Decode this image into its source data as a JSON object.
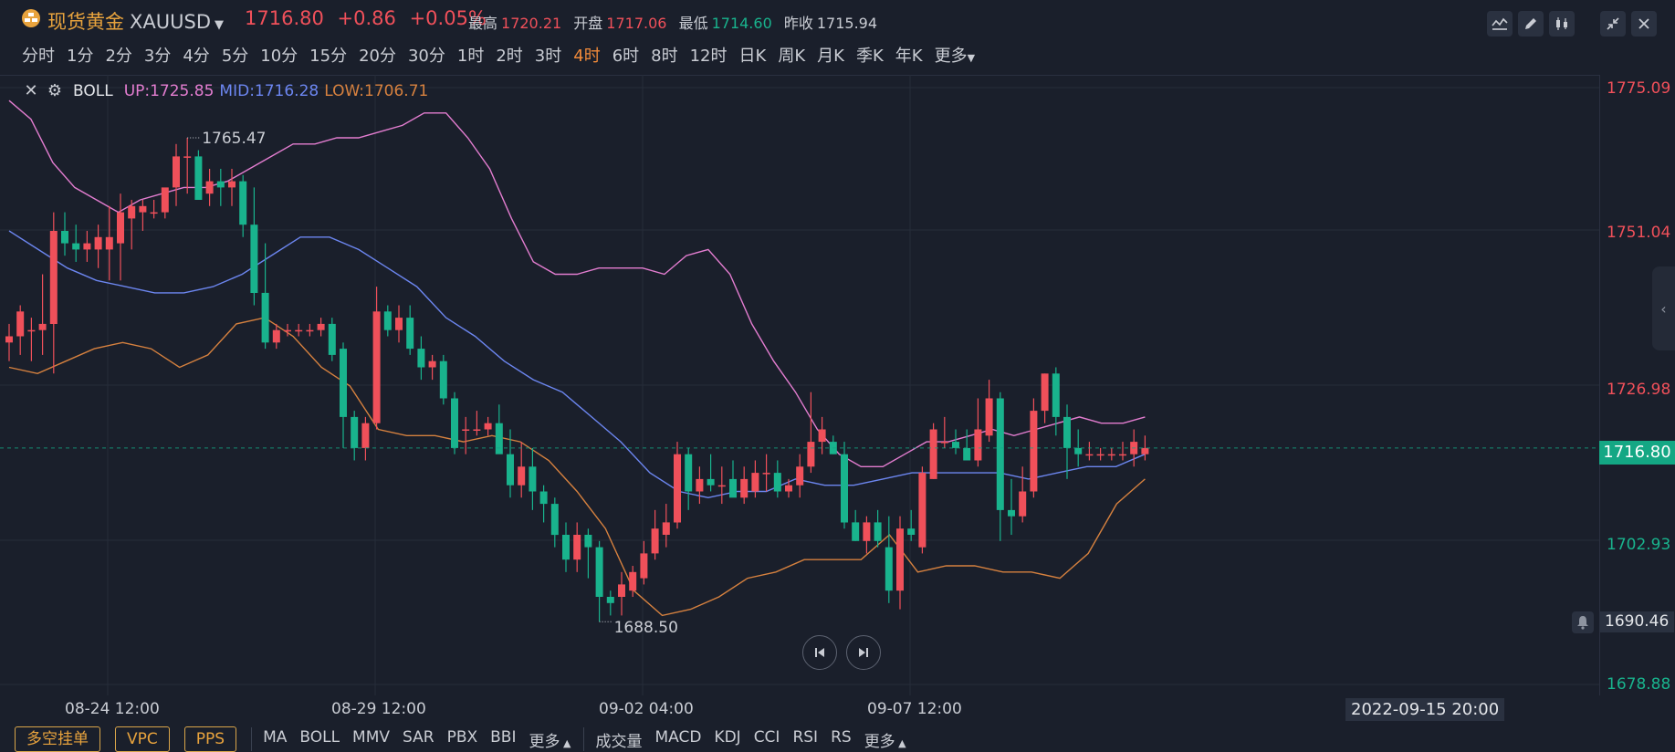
{
  "header": {
    "title_cn": "现货黄金",
    "symbol": "XAUUSD",
    "price": "1716.80",
    "change": "+0.86",
    "change_pct": "+0.05%",
    "stats": [
      {
        "label": "最高",
        "value": "1720.21",
        "color": "red"
      },
      {
        "label": "开盘",
        "value": "1717.06",
        "color": "red"
      },
      {
        "label": "最低",
        "value": "1714.60",
        "color": "green"
      },
      {
        "label": "昨收",
        "value": "1715.94",
        "color": "white"
      }
    ]
  },
  "timeframes": [
    "分时",
    "1分",
    "2分",
    "3分",
    "4分",
    "5分",
    "10分",
    "15分",
    "20分",
    "30分",
    "1时",
    "2时",
    "3时",
    "4时",
    "6时",
    "8时",
    "12时",
    "日K",
    "周K",
    "月K",
    "季K",
    "年K",
    "更多"
  ],
  "active_timeframe": "4时",
  "indicator": {
    "name": "BOLL",
    "up": "UP:1725.85",
    "mid": "MID:1716.28",
    "low": "LOW:1706.71"
  },
  "y_axis": {
    "labels": [
      {
        "text": "1775.09",
        "color": "red"
      },
      {
        "text": "1751.04",
        "color": "red"
      },
      {
        "text": "1726.98",
        "color": "red"
      },
      {
        "text": "1702.93",
        "color": "green"
      },
      {
        "text": "1690.46",
        "color": "white"
      },
      {
        "text": "1678.88",
        "color": "green"
      }
    ],
    "current_price": "1716.80"
  },
  "x_axis": {
    "labels": [
      "08-24 12:00",
      "08-29 12:00",
      "09-02 04:00",
      "09-07 12:00"
    ],
    "current": "2022-09-15 20:00"
  },
  "annotations": {
    "high": "1765.47",
    "low": "1688.50"
  },
  "bottom": {
    "buttons": [
      "多空挂单",
      "VPC",
      "PPS"
    ],
    "main_indicators": [
      "MA",
      "BOLL",
      "MMV",
      "SAR",
      "PBX",
      "BBI",
      "更多"
    ],
    "sub_indicators": [
      "成交量",
      "MACD",
      "KDJ",
      "CCI",
      "RSI",
      "RS",
      "更多"
    ]
  },
  "colors": {
    "up": "#f0505a",
    "down": "#19b38d",
    "boll_up": "#e37dd0",
    "boll_mid": "#6c86f0",
    "boll_low": "#d6813f",
    "accent": "#e8a33d"
  },
  "chart_data": {
    "type": "candlestick",
    "ylim": [
      1678.88,
      1775.09
    ],
    "candles": [
      {
        "o": 1734,
        "h": 1737,
        "l": 1731,
        "c": 1735
      },
      {
        "o": 1735,
        "h": 1740,
        "l": 1732,
        "c": 1739
      },
      {
        "o": 1736,
        "h": 1738,
        "l": 1731,
        "c": 1736
      },
      {
        "o": 1736,
        "h": 1745,
        "l": 1732,
        "c": 1737
      },
      {
        "o": 1737,
        "h": 1755,
        "l": 1729,
        "c": 1752
      },
      {
        "o": 1752,
        "h": 1755,
        "l": 1748,
        "c": 1750
      },
      {
        "o": 1750,
        "h": 1753,
        "l": 1747,
        "c": 1749
      },
      {
        "o": 1749,
        "h": 1752,
        "l": 1747,
        "c": 1750
      },
      {
        "o": 1749,
        "h": 1753,
        "l": 1746,
        "c": 1751
      },
      {
        "o": 1749,
        "h": 1756,
        "l": 1744,
        "c": 1751
      },
      {
        "o": 1750,
        "h": 1758,
        "l": 1744,
        "c": 1755
      },
      {
        "o": 1754,
        "h": 1757,
        "l": 1749,
        "c": 1756
      },
      {
        "o": 1755,
        "h": 1757,
        "l": 1752,
        "c": 1756
      },
      {
        "o": 1755,
        "h": 1757,
        "l": 1754,
        "c": 1755
      },
      {
        "o": 1755,
        "h": 1758,
        "l": 1754,
        "c": 1759
      },
      {
        "o": 1759,
        "h": 1766,
        "l": 1756,
        "c": 1764
      },
      {
        "o": 1764,
        "h": 1767,
        "l": 1758,
        "c": 1764
      },
      {
        "o": 1764,
        "h": 1765,
        "l": 1757,
        "c": 1757
      },
      {
        "o": 1758,
        "h": 1762,
        "l": 1756,
        "c": 1760
      },
      {
        "o": 1760,
        "h": 1762,
        "l": 1756,
        "c": 1759
      },
      {
        "o": 1759,
        "h": 1762,
        "l": 1756,
        "c": 1760
      },
      {
        "o": 1760,
        "h": 1761,
        "l": 1751,
        "c": 1753
      },
      {
        "o": 1753,
        "h": 1759,
        "l": 1740,
        "c": 1742
      },
      {
        "o": 1742,
        "h": 1750,
        "l": 1733,
        "c": 1734
      },
      {
        "o": 1734,
        "h": 1737,
        "l": 1733,
        "c": 1736
      },
      {
        "o": 1736,
        "h": 1737,
        "l": 1735,
        "c": 1736
      },
      {
        "o": 1736,
        "h": 1737,
        "l": 1735,
        "c": 1736
      },
      {
        "o": 1736,
        "h": 1737,
        "l": 1735,
        "c": 1736
      },
      {
        "o": 1736,
        "h": 1738,
        "l": 1735,
        "c": 1737
      },
      {
        "o": 1737,
        "h": 1738,
        "l": 1731,
        "c": 1732
      },
      {
        "o": 1733,
        "h": 1734,
        "l": 1717,
        "c": 1722
      },
      {
        "o": 1722,
        "h": 1723,
        "l": 1715,
        "c": 1717
      },
      {
        "o": 1717,
        "h": 1722,
        "l": 1715,
        "c": 1721
      },
      {
        "o": 1721,
        "h": 1743,
        "l": 1720,
        "c": 1739
      },
      {
        "o": 1739,
        "h": 1740,
        "l": 1735,
        "c": 1736
      },
      {
        "o": 1736,
        "h": 1740,
        "l": 1734,
        "c": 1738
      },
      {
        "o": 1738,
        "h": 1740,
        "l": 1732,
        "c": 1733
      },
      {
        "o": 1733,
        "h": 1735,
        "l": 1728,
        "c": 1730
      },
      {
        "o": 1730,
        "h": 1732,
        "l": 1728,
        "c": 1731
      },
      {
        "o": 1731,
        "h": 1732,
        "l": 1724,
        "c": 1725
      },
      {
        "o": 1725,
        "h": 1726,
        "l": 1716,
        "c": 1717
      },
      {
        "o": 1720,
        "h": 1722,
        "l": 1716,
        "c": 1720
      },
      {
        "o": 1720,
        "h": 1723,
        "l": 1719,
        "c": 1720
      },
      {
        "o": 1720,
        "h": 1722,
        "l": 1719,
        "c": 1721
      },
      {
        "o": 1721,
        "h": 1724,
        "l": 1717,
        "c": 1716
      },
      {
        "o": 1716,
        "h": 1720,
        "l": 1709,
        "c": 1711
      },
      {
        "o": 1711,
        "h": 1718,
        "l": 1709,
        "c": 1714
      },
      {
        "o": 1714,
        "h": 1717,
        "l": 1707,
        "c": 1710
      },
      {
        "o": 1710,
        "h": 1711,
        "l": 1705,
        "c": 1708
      },
      {
        "o": 1708,
        "h": 1709,
        "l": 1701,
        "c": 1703
      },
      {
        "o": 1703,
        "h": 1705,
        "l": 1697,
        "c": 1699
      },
      {
        "o": 1699,
        "h": 1705,
        "l": 1697,
        "c": 1703
      },
      {
        "o": 1703,
        "h": 1704,
        "l": 1696,
        "c": 1701
      },
      {
        "o": 1701,
        "h": 1702,
        "l": 1689,
        "c": 1693
      },
      {
        "o": 1693,
        "h": 1694,
        "l": 1690,
        "c": 1692
      },
      {
        "o": 1693,
        "h": 1697,
        "l": 1690,
        "c": 1695
      },
      {
        "o": 1694,
        "h": 1698,
        "l": 1693,
        "c": 1697
      },
      {
        "o": 1696,
        "h": 1702,
        "l": 1695,
        "c": 1700
      },
      {
        "o": 1700,
        "h": 1707,
        "l": 1699,
        "c": 1704
      },
      {
        "o": 1703,
        "h": 1708,
        "l": 1701,
        "c": 1705
      },
      {
        "o": 1705,
        "h": 1718,
        "l": 1704,
        "c": 1716
      },
      {
        "o": 1716,
        "h": 1717,
        "l": 1707,
        "c": 1710
      },
      {
        "o": 1710,
        "h": 1714,
        "l": 1708,
        "c": 1712
      },
      {
        "o": 1712,
        "h": 1716,
        "l": 1710,
        "c": 1711
      },
      {
        "o": 1711,
        "h": 1714,
        "l": 1708,
        "c": 1711
      },
      {
        "o": 1712,
        "h": 1715,
        "l": 1710,
        "c": 1709
      },
      {
        "o": 1709,
        "h": 1714,
        "l": 1708,
        "c": 1712
      },
      {
        "o": 1710,
        "h": 1715,
        "l": 1709,
        "c": 1713
      },
      {
        "o": 1713,
        "h": 1716,
        "l": 1710,
        "c": 1713
      },
      {
        "o": 1713,
        "h": 1715,
        "l": 1709,
        "c": 1710
      },
      {
        "o": 1710,
        "h": 1712,
        "l": 1709,
        "c": 1711
      },
      {
        "o": 1711,
        "h": 1716,
        "l": 1709,
        "c": 1714
      },
      {
        "o": 1714,
        "h": 1726,
        "l": 1713,
        "c": 1718
      },
      {
        "o": 1718,
        "h": 1722,
        "l": 1716,
        "c": 1720
      },
      {
        "o": 1718,
        "h": 1719,
        "l": 1716,
        "c": 1716
      },
      {
        "o": 1716,
        "h": 1718,
        "l": 1704,
        "c": 1705
      },
      {
        "o": 1705,
        "h": 1707,
        "l": 1702,
        "c": 1702
      },
      {
        "o": 1702,
        "h": 1706,
        "l": 1700,
        "c": 1705
      },
      {
        "o": 1705,
        "h": 1707,
        "l": 1701,
        "c": 1702
      },
      {
        "o": 1701,
        "h": 1706,
        "l": 1692,
        "c": 1694
      },
      {
        "o": 1694,
        "h": 1706,
        "l": 1691,
        "c": 1704
      },
      {
        "o": 1704,
        "h": 1707,
        "l": 1702,
        "c": 1703
      },
      {
        "o": 1701,
        "h": 1714,
        "l": 1700,
        "c": 1713
      },
      {
        "o": 1712,
        "h": 1721,
        "l": 1712,
        "c": 1720
      },
      {
        "o": 1718,
        "h": 1722,
        "l": 1717,
        "c": 1718
      },
      {
        "o": 1718,
        "h": 1720,
        "l": 1716,
        "c": 1717
      },
      {
        "o": 1717,
        "h": 1720,
        "l": 1715,
        "c": 1715
      },
      {
        "o": 1715,
        "h": 1725,
        "l": 1714,
        "c": 1720
      },
      {
        "o": 1719,
        "h": 1728,
        "l": 1718,
        "c": 1725
      },
      {
        "o": 1725,
        "h": 1726,
        "l": 1702,
        "c": 1707
      },
      {
        "o": 1707,
        "h": 1712,
        "l": 1703,
        "c": 1706
      },
      {
        "o": 1706,
        "h": 1714,
        "l": 1705,
        "c": 1710
      },
      {
        "o": 1710,
        "h": 1725,
        "l": 1709,
        "c": 1723
      },
      {
        "o": 1723,
        "h": 1729,
        "l": 1721,
        "c": 1729
      },
      {
        "o": 1729,
        "h": 1730,
        "l": 1719,
        "c": 1722
      },
      {
        "o": 1722,
        "h": 1724,
        "l": 1712,
        "c": 1717
      },
      {
        "o": 1717,
        "h": 1720,
        "l": 1714,
        "c": 1716
      },
      {
        "o": 1716,
        "h": 1718,
        "l": 1715,
        "c": 1716
      },
      {
        "o": 1716,
        "h": 1717,
        "l": 1715,
        "c": 1716
      },
      {
        "o": 1716,
        "h": 1717,
        "l": 1715,
        "c": 1716
      },
      {
        "o": 1716,
        "h": 1718,
        "l": 1715,
        "c": 1716
      },
      {
        "o": 1716,
        "h": 1720,
        "l": 1714,
        "c": 1718
      },
      {
        "o": 1716,
        "h": 1719,
        "l": 1715,
        "c": 1717
      }
    ],
    "boll_up": [
      1773,
      1770,
      1763,
      1759,
      1757,
      1755,
      1757,
      1758,
      1759,
      1759,
      1760,
      1762,
      1764,
      1766,
      1766,
      1767,
      1767,
      1768,
      1769,
      1771,
      1771,
      1767,
      1762,
      1754,
      1747,
      1745,
      1745,
      1746,
      1746,
      1746,
      1745,
      1748,
      1749,
      1745,
      1737,
      1731,
      1726,
      1720,
      1716,
      1714,
      1714,
      1716,
      1718,
      1718,
      1719,
      1720,
      1719,
      1720,
      1721,
      1722,
      1721,
      1721,
      1722
    ],
    "boll_mid": [
      1752,
      1749,
      1746,
      1744,
      1743,
      1742,
      1742,
      1743,
      1745,
      1748,
      1751,
      1751,
      1749,
      1746,
      1743,
      1738,
      1735,
      1731,
      1728,
      1726,
      1722,
      1718,
      1713,
      1710,
      1709,
      1710,
      1710,
      1712,
      1711,
      1711,
      1712,
      1713,
      1713,
      1713,
      1713,
      1712,
      1713,
      1714,
      1714,
      1716
    ],
    "boll_low": [
      1730,
      1729,
      1731,
      1733,
      1734,
      1733,
      1730,
      1732,
      1737,
      1738,
      1735,
      1730,
      1727,
      1720,
      1719,
      1719,
      1718,
      1719,
      1718,
      1715,
      1710,
      1704,
      1694,
      1690,
      1691,
      1693,
      1696,
      1697,
      1699,
      1699,
      1699,
      1703,
      1697,
      1698,
      1698,
      1697,
      1697,
      1696,
      1700,
      1708,
      1712
    ]
  }
}
